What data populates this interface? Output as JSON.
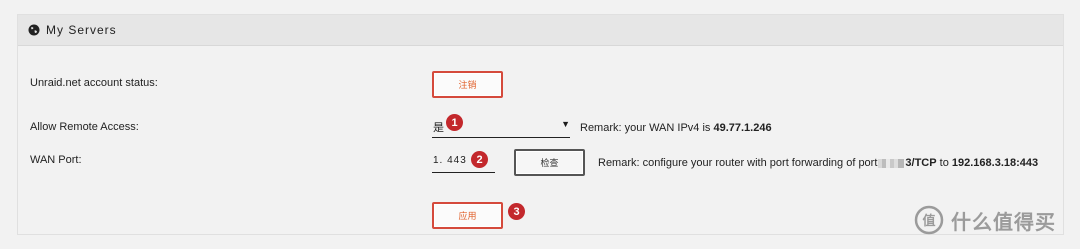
{
  "panel": {
    "title": "My Servers",
    "globe_icon": "globe-icon"
  },
  "rows": {
    "account_status": {
      "label": "Unraid.net account status:",
      "button_label": "注销"
    },
    "remote_access": {
      "label": "Allow Remote Access:",
      "selected": "是",
      "remark_prefix": "Remark: your WAN IPv4 is ",
      "remark_value": "49.77.1.246",
      "badge": "1"
    },
    "wan_port": {
      "label": "WAN Port:",
      "value": "1. 443",
      "check_label": "检查",
      "remark_prefix": "Remark: configure your router with port forwarding of port",
      "remark_port_suffix": "3/TCP",
      "remark_to": " to ",
      "remark_target": "192.168.3.18:443",
      "badge": "2"
    },
    "apply": {
      "button_label": "应用",
      "badge": "3"
    }
  },
  "watermark": {
    "text": "什么值得买",
    "icon": "value-logo-icon"
  },
  "colors": {
    "accent": "#e1622c",
    "badge": "#c3282c",
    "header_bg": "#e6e6e6"
  }
}
